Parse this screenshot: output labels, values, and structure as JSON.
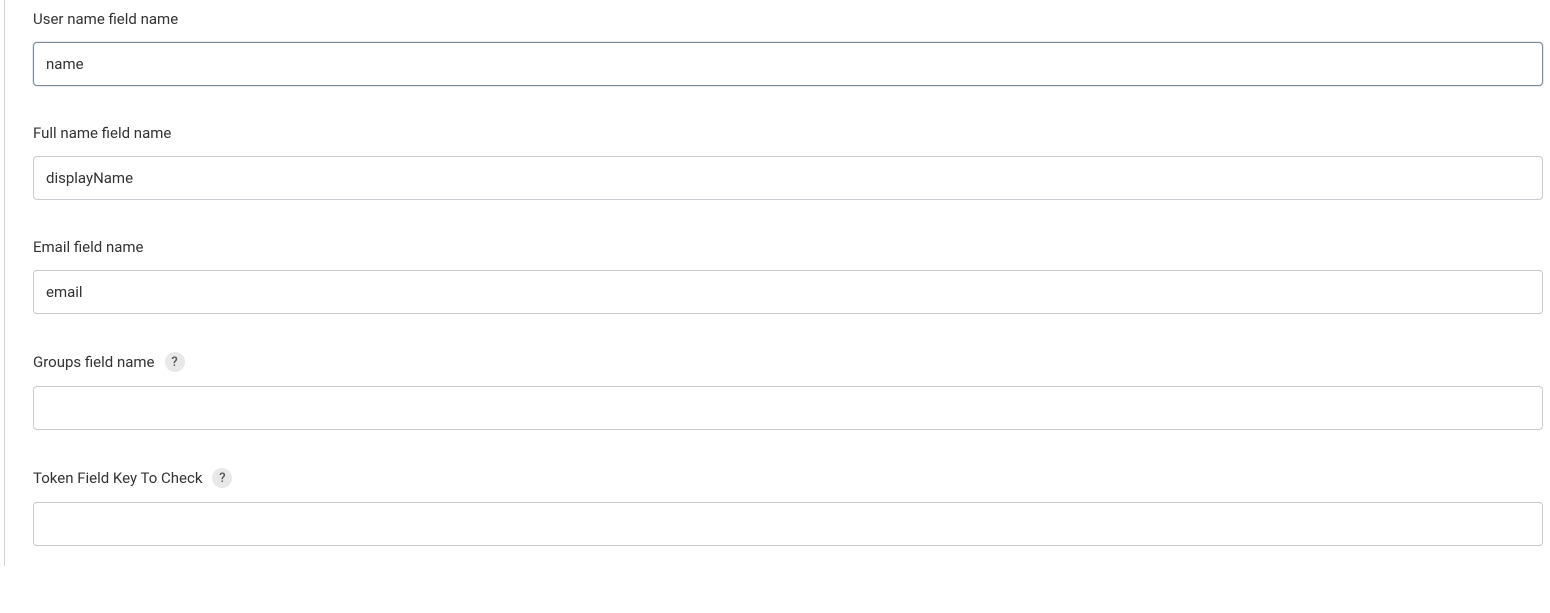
{
  "fields": {
    "username": {
      "label": "User name field name",
      "value": "name",
      "focused": true,
      "hasHelp": false
    },
    "fullname": {
      "label": "Full name field name",
      "value": "displayName",
      "focused": false,
      "hasHelp": false
    },
    "email": {
      "label": "Email field name",
      "value": "email",
      "focused": false,
      "hasHelp": false
    },
    "groups": {
      "label": "Groups field name",
      "value": "",
      "focused": false,
      "hasHelp": true
    },
    "tokenKey": {
      "label": "Token Field Key To Check",
      "value": "",
      "focused": false,
      "hasHelp": true
    }
  },
  "helpGlyph": "?"
}
